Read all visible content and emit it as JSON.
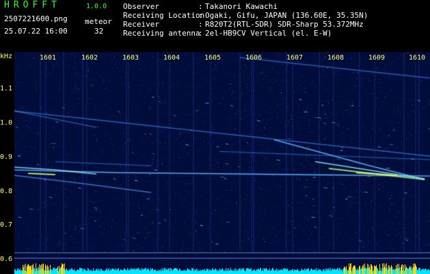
{
  "header": {
    "app_title": "HROFFT",
    "app_version": "1.0.0",
    "file_name": "2507221600.png",
    "meteor_label": "meteor",
    "date_time": "25.07.22 16:00",
    "meteor_count": "32"
  },
  "info": [
    {
      "key": "Observer",
      "value": "Takanori Kawachi"
    },
    {
      "key": "Receiving Location",
      "value": "Ogaki, Gifu, JAPAN (136.60E, 35.35N)"
    },
    {
      "key": "Receiver",
      "value": "R820T2(RTL-SDR) SDR-Sharp 53.372MHz"
    },
    {
      "key": "Receiving antenna",
      "value": "2el-HB9CV Vertical (el. E-W)"
    }
  ],
  "spectrogram": {
    "y_unit": "kHz",
    "y_ticks": [
      "1.1",
      "1.0",
      "0.9",
      "0.8",
      "0.7",
      "0.6"
    ],
    "x_ticks": [
      "1601",
      "1602",
      "1603",
      "1604",
      "1605",
      "1606",
      "1607",
      "1608",
      "1609",
      "1610"
    ],
    "colors": {
      "background": "#000c3a",
      "label": "#ffff66",
      "title": "#33ff33",
      "signal": "#3fa0ff",
      "bar": "#00e5ff",
      "bar_peak": "#ffd800"
    }
  }
}
